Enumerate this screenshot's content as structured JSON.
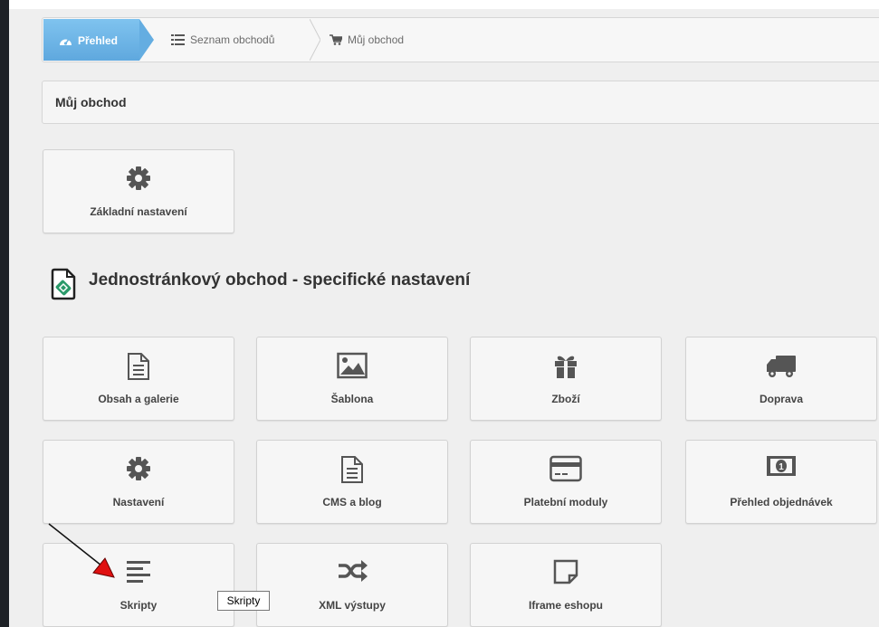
{
  "breadcrumb": {
    "items": [
      {
        "label": "Přehled",
        "icon": "dashboard-icon",
        "active": true
      },
      {
        "label": "Seznam obchodů",
        "icon": "list-icon",
        "active": false
      },
      {
        "label": "Můj obchod",
        "icon": "cart-icon",
        "active": false
      }
    ]
  },
  "panel": {
    "title": "Můj obchod"
  },
  "basic": {
    "label": "Základní nastavení",
    "icon": "gear-icon"
  },
  "section": {
    "title": "Jednostránkový obchod - specifické nastavení",
    "icon": "onepage-shop-icon"
  },
  "tiles": [
    {
      "label": "Obsah a galerie",
      "icon": "document-icon"
    },
    {
      "label": "Šablona",
      "icon": "image-icon"
    },
    {
      "label": "Zboží",
      "icon": "gift-icon"
    },
    {
      "label": "Doprava",
      "icon": "truck-icon"
    },
    {
      "label": "Nastavení",
      "icon": "gear-icon"
    },
    {
      "label": "CMS a blog",
      "icon": "document-icon"
    },
    {
      "label": "Platební moduly",
      "icon": "credit-card-icon"
    },
    {
      "label": "Přehled objednávek",
      "icon": "money-icon"
    },
    {
      "label": "Skripty",
      "icon": "align-left-icon"
    },
    {
      "label": "XML výstupy",
      "icon": "shuffle-icon"
    },
    {
      "label": "Iframe eshopu",
      "icon": "sticky-note-icon"
    }
  ],
  "tooltip": {
    "text": "Skripty"
  },
  "colors": {
    "active_crumb": "#6cb4e6",
    "arrow": "#e01010",
    "icon": "#555555"
  }
}
